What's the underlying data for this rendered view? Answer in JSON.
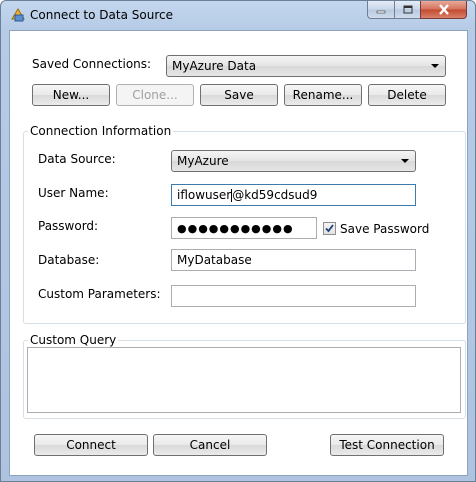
{
  "window": {
    "title": "Connect to Data Source"
  },
  "saved": {
    "label": "Saved Connections:",
    "selected": "MyAzure Data",
    "buttons": {
      "new": "New...",
      "clone": "Clone...",
      "save": "Save",
      "rename": "Rename...",
      "delete": "Delete"
    }
  },
  "connection": {
    "group_title": "Connection Information",
    "data_source": {
      "label": "Data Source:",
      "value": "MyAzure"
    },
    "user_name": {
      "label": "User Name:",
      "value_before_caret": "iflowuser",
      "value_after_caret": "@kd59cdsud9"
    },
    "password": {
      "label": "Password:",
      "value": "●●●●●●●●●●●"
    },
    "save_password": {
      "label": "Save Password",
      "checked": true
    },
    "database": {
      "label": "Database:",
      "value": "MyDatabase"
    },
    "custom_parameters": {
      "label": "Custom Parameters:",
      "value": ""
    }
  },
  "custom_query": {
    "group_title": "Custom Query",
    "value": ""
  },
  "footer": {
    "connect": "Connect",
    "cancel": "Cancel",
    "test": "Test Connection"
  },
  "icons": {
    "app": "database-connect-icon",
    "min": "minimize-icon",
    "max": "maximize-icon",
    "close": "close-icon",
    "check": "checkmark-icon"
  },
  "colors": {
    "titlebar": "#b6cbe6",
    "close": "#c24a30",
    "focus_border": "#3d7bad"
  }
}
